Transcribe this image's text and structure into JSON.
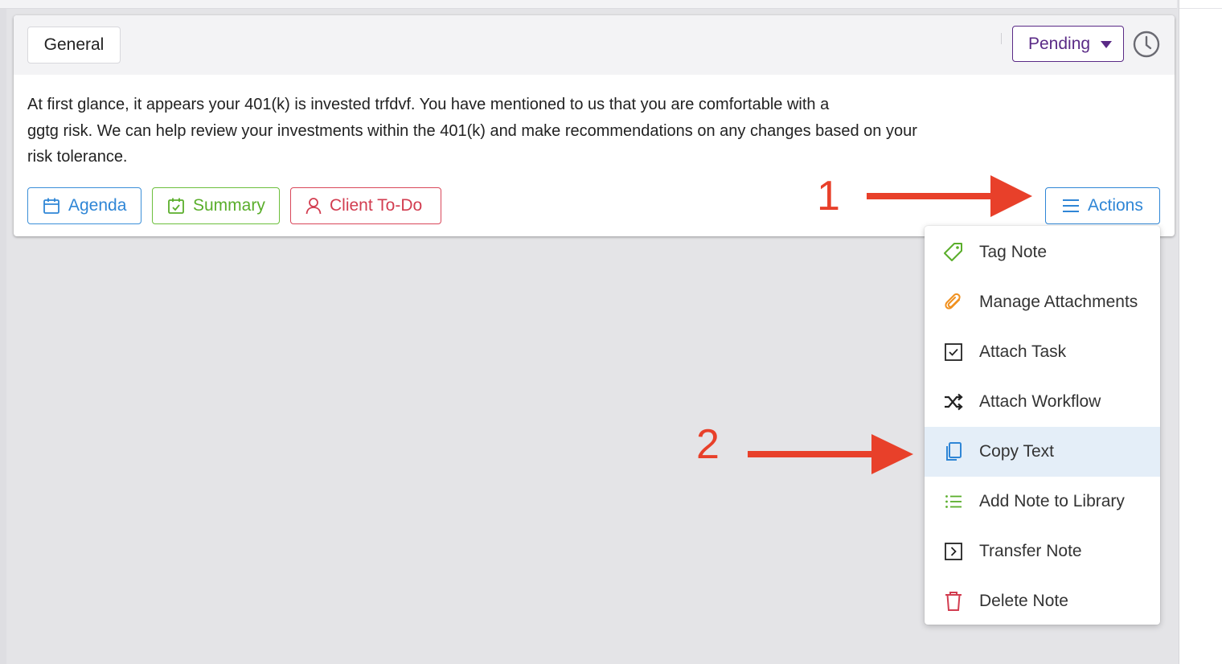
{
  "card": {
    "category_tag": "General",
    "status": {
      "value": "Pending",
      "color": "#5a2a86"
    },
    "history_icon": "clock-icon",
    "note_lines": [
      "At first glance, it appears your 401(k) is invested trfdvf. You have mentioned to us that you are comfortable with a",
      "ggtg risk. We can help review your investments within the 401(k) and make recommendations on any changes based on your",
      "risk tolerance."
    ],
    "buttons": {
      "agenda": {
        "label": "Agenda",
        "icon": "calendar-icon",
        "color": "#2f86d6"
      },
      "summary": {
        "label": "Summary",
        "icon": "calendar-check-icon",
        "color": "#5aae2b"
      },
      "client_todo": {
        "label": "Client To-Do",
        "icon": "user-icon",
        "color": "#d23d50"
      },
      "actions": {
        "label": "Actions",
        "icon": "hamburger-icon",
        "color": "#2f86d6"
      }
    }
  },
  "actions_menu": {
    "highlighted_item": "Copy Text",
    "items": [
      {
        "label": "Tag Note",
        "icon": "tag-icon",
        "color": "#5aae2b"
      },
      {
        "label": "Manage Attachments",
        "icon": "paperclip-icon",
        "color": "#f0901e"
      },
      {
        "label": "Attach Task",
        "icon": "checkbox-icon",
        "color": "#222222"
      },
      {
        "label": "Attach Workflow",
        "icon": "shuffle-icon",
        "color": "#222222"
      },
      {
        "label": "Copy Text",
        "icon": "copy-icon",
        "color": "#2f86d6"
      },
      {
        "label": "Add Note to Library",
        "icon": "list-icon",
        "color": "#5aae2b"
      },
      {
        "label": "Transfer Note",
        "icon": "transfer-icon",
        "color": "#222222"
      },
      {
        "label": "Delete Note",
        "icon": "trash-icon",
        "color": "#d23d50"
      }
    ]
  },
  "annotations": {
    "step_1": "1",
    "step_2": "2",
    "color": "#e8402a"
  }
}
